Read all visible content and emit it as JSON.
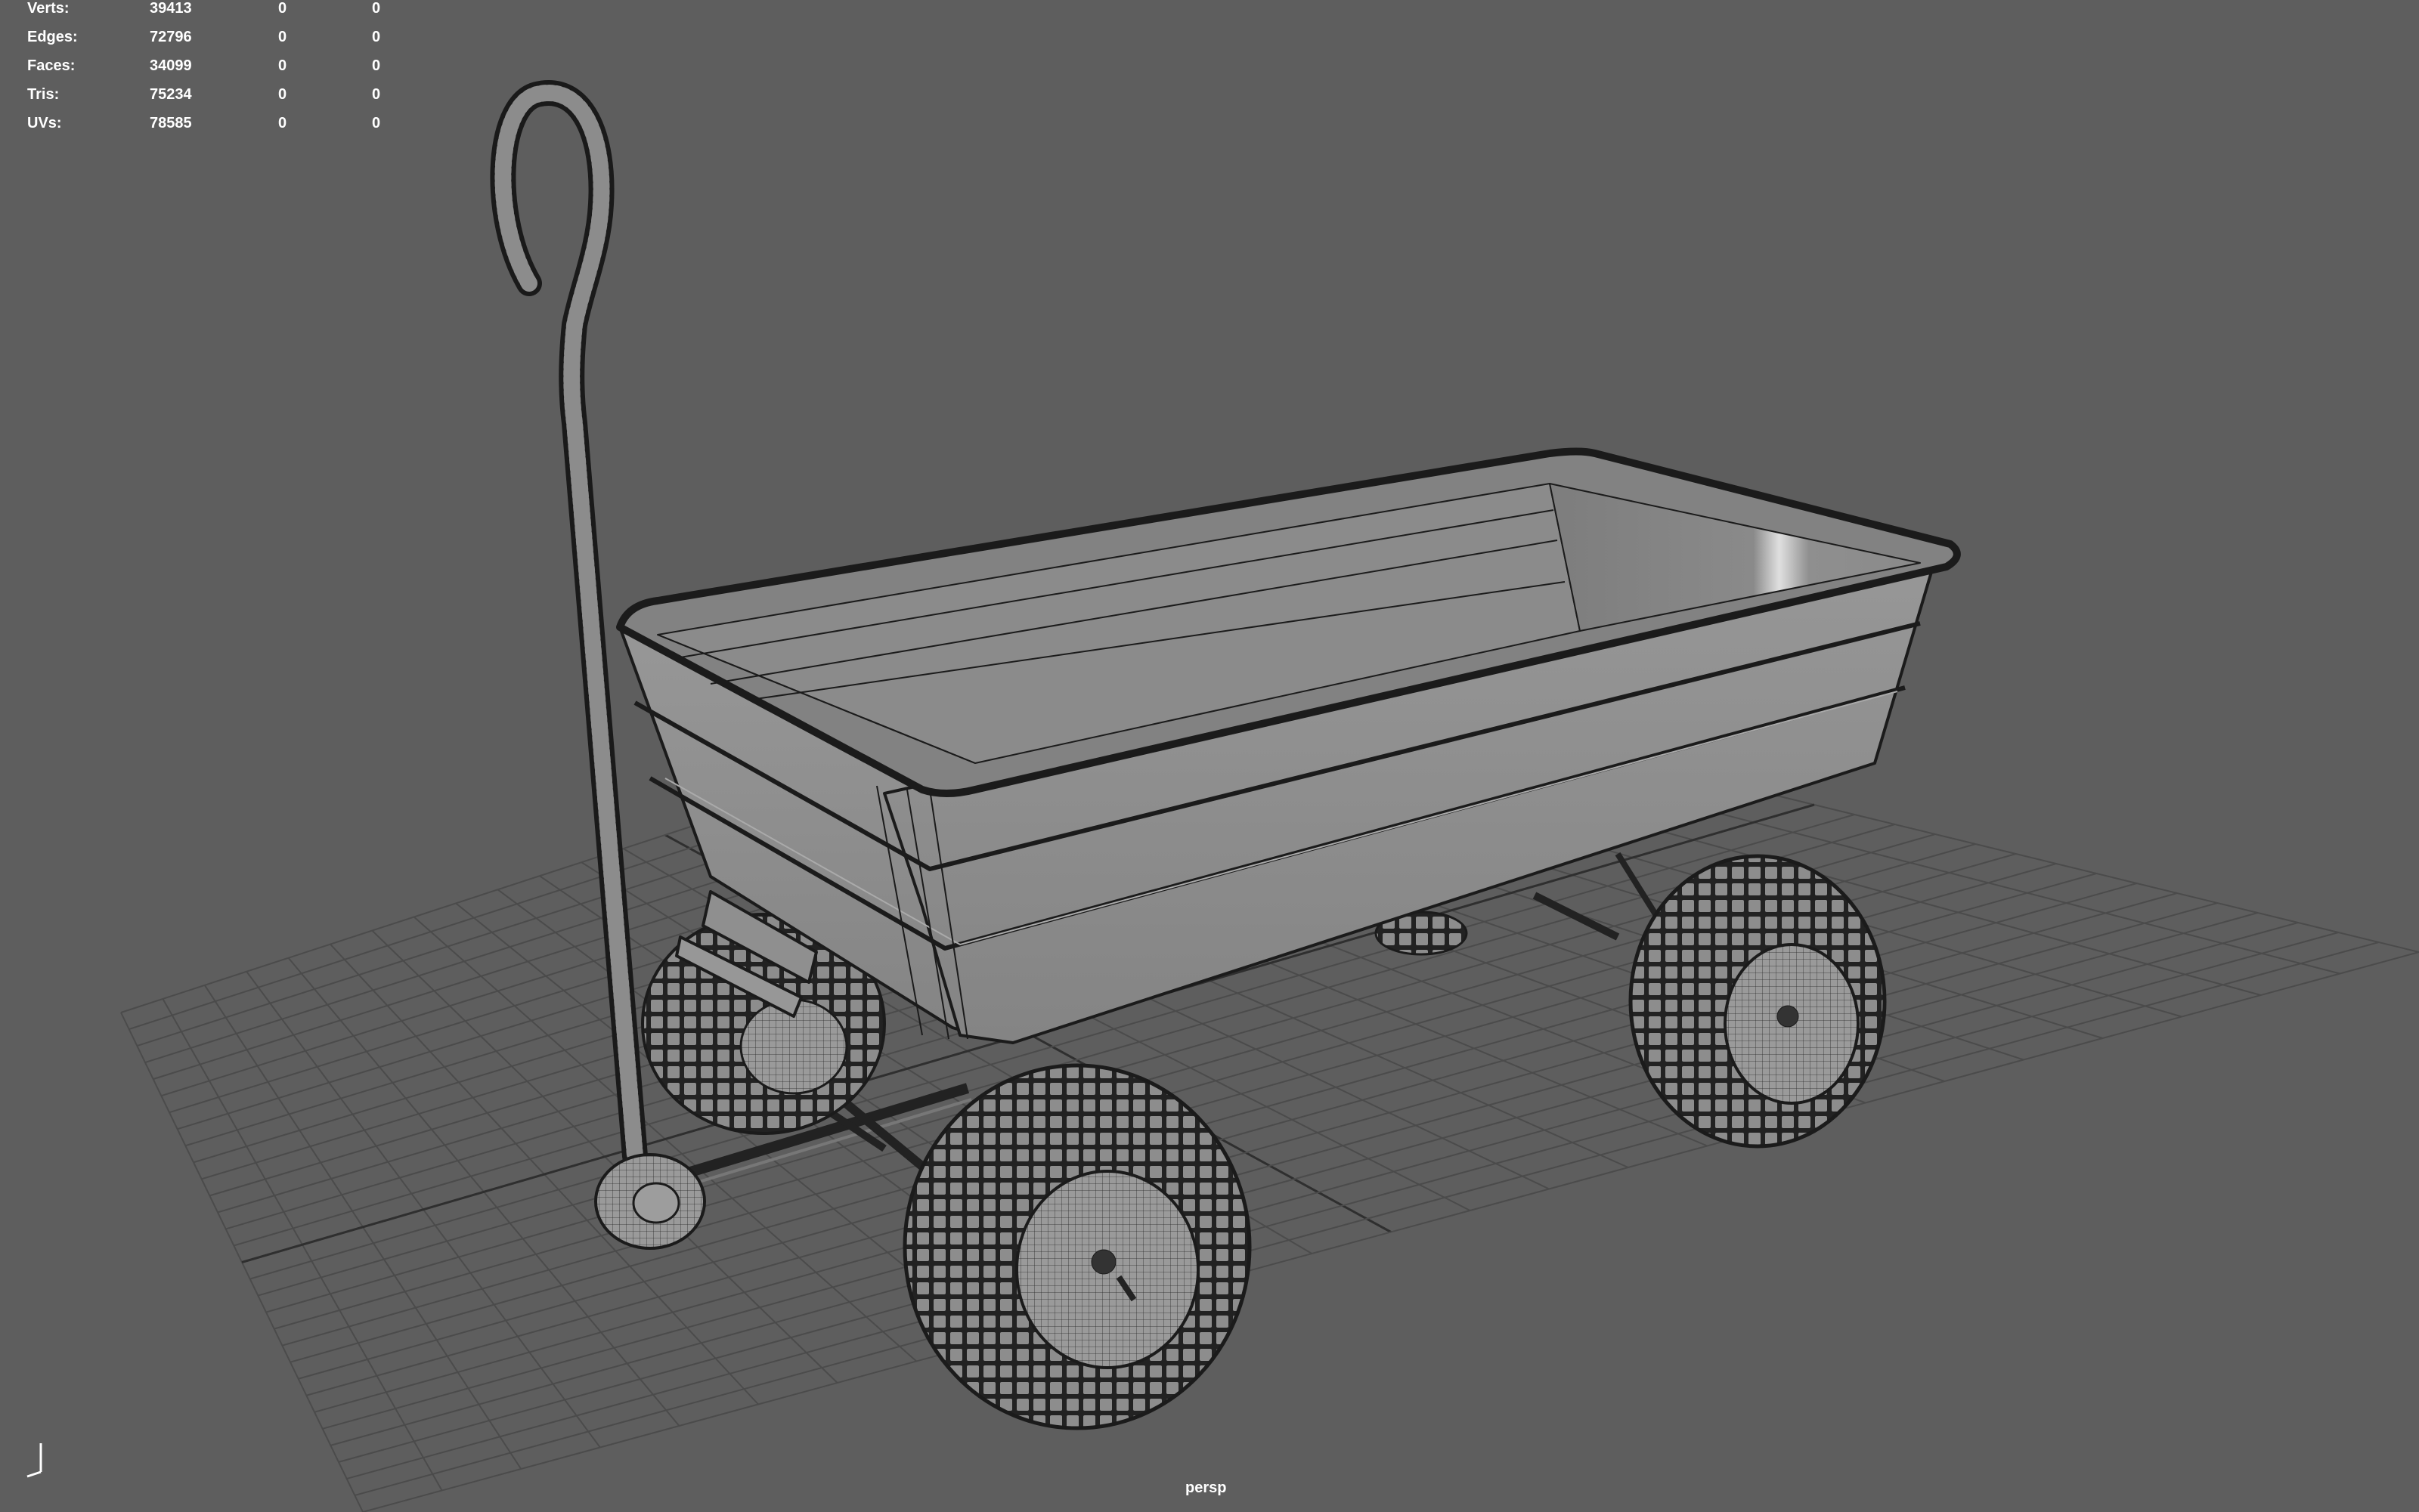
{
  "viewport": {
    "camera_label": "persp",
    "background_color": "#5e5e5e",
    "grid_color": "#4b4b4b",
    "grid_axis_color": "#2f2f2f"
  },
  "hud": {
    "rows": [
      {
        "label": "Verts:",
        "c1": "39413",
        "c2": "0",
        "c3": "0"
      },
      {
        "label": "Edges:",
        "c1": "72796",
        "c2": "0",
        "c3": "0"
      },
      {
        "label": "Faces:",
        "c1": "34099",
        "c2": "0",
        "c3": "0"
      },
      {
        "label": "Tris:",
        "c1": "75234",
        "c2": "0",
        "c3": "0"
      },
      {
        "label": "UVs:",
        "c1": "78585",
        "c2": "0",
        "c3": "0"
      }
    ]
  },
  "model": {
    "icon": "wagon-wireframe-icon",
    "shading_color": "#8e8e8e",
    "wire_color": "#1e1e1e"
  },
  "gizmo": {
    "icon": "axis-gizmo-icon"
  }
}
